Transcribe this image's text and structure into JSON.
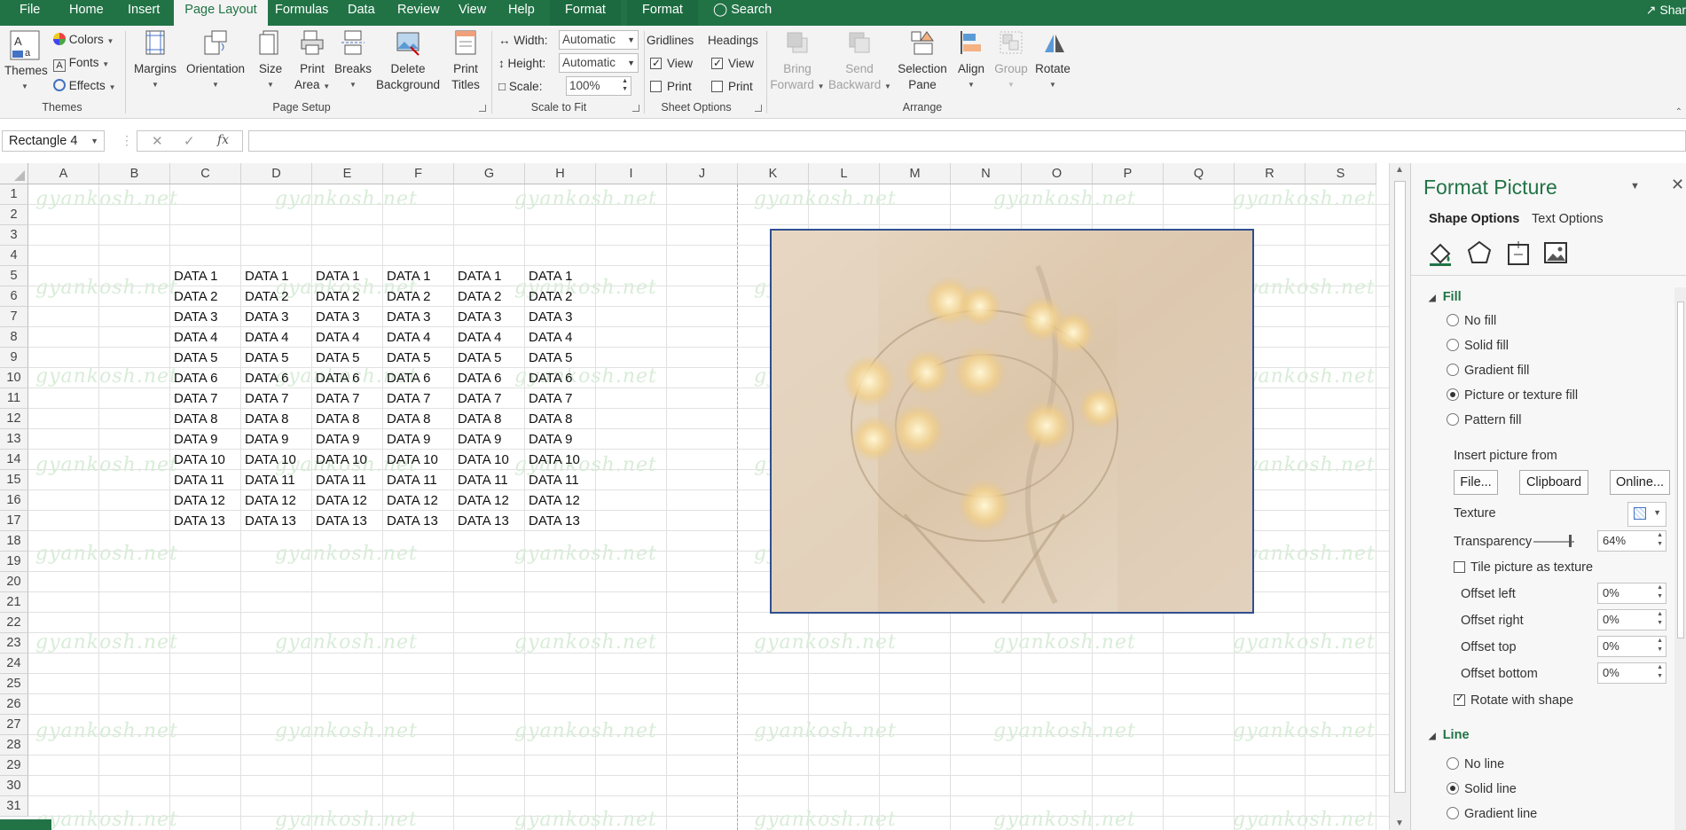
{
  "tabs": [
    "File",
    "Home",
    "Insert",
    "Page Layout",
    "Formulas",
    "Data",
    "Review",
    "View",
    "Help",
    "Format",
    "Format"
  ],
  "active_tab": "Page Layout",
  "search_label": "Search",
  "share_label": "Shar",
  "ribbon": {
    "themes": {
      "themes_label": "Themes",
      "colors": "Colors",
      "fonts": "Fonts",
      "effects": "Effects",
      "group": "Themes"
    },
    "page_setup": {
      "margins": "Margins",
      "orientation": "Orientation",
      "size": "Size",
      "print_area": [
        "Print",
        "Area"
      ],
      "breaks": "Breaks",
      "delete_background": [
        "Delete",
        "Background"
      ],
      "print_titles": [
        "Print",
        "Titles"
      ],
      "group": "Page Setup"
    },
    "scale_to_fit": {
      "width_label": "Width:",
      "width_value": "Automatic",
      "height_label": "Height:",
      "height_value": "Automatic",
      "scale_label": "Scale:",
      "scale_value": "100%",
      "group": "Scale to Fit"
    },
    "sheet_options": {
      "gridlines": "Gridlines",
      "headings": "Headings",
      "view": "View",
      "print": "Print",
      "group": "Sheet Options"
    },
    "arrange": {
      "bring_forward": [
        "Bring",
        "Forward"
      ],
      "send_backward": [
        "Send",
        "Backward"
      ],
      "selection_pane": [
        "Selection",
        "Pane"
      ],
      "align": "Align",
      "group_btn": "Group",
      "rotate": "Rotate",
      "group": "Arrange"
    }
  },
  "formula_bar": {
    "name_box": "Rectangle 4",
    "fx": "fx",
    "value": ""
  },
  "grid": {
    "columns": [
      "A",
      "B",
      "C",
      "D",
      "E",
      "F",
      "G",
      "H",
      "I",
      "J",
      "K",
      "L",
      "M",
      "N",
      "O",
      "P",
      "Q",
      "R",
      "S"
    ],
    "rows": [
      "1",
      "2",
      "3",
      "4",
      "5",
      "6",
      "7",
      "8",
      "9",
      "10",
      "11",
      "12",
      "13",
      "14",
      "15",
      "16",
      "17",
      "18",
      "19",
      "20",
      "21",
      "22",
      "23",
      "24",
      "25",
      "26",
      "27",
      "28",
      "29",
      "30",
      "31"
    ],
    "data_values": [
      "DATA 1",
      "DATA 2",
      "DATA 3",
      "DATA 4",
      "DATA 5",
      "DATA 6",
      "DATA 7",
      "DATA 8",
      "DATA 9",
      "DATA 10",
      "DATA 11",
      "DATA 12",
      "DATA 13"
    ],
    "data_columns": [
      "C",
      "D",
      "E",
      "F",
      "G",
      "H"
    ],
    "data_start_row": 5,
    "watermark": "gyankosh.net"
  },
  "pane": {
    "title": "Format Picture",
    "tab_shape": "Shape Options",
    "tab_text": "Text Options",
    "fill_header": "Fill",
    "fill_options": [
      "No fill",
      "Solid fill",
      "Gradient fill",
      "Picture or texture fill",
      "Pattern fill"
    ],
    "fill_selected": "Picture or texture fill",
    "insert_from": "Insert picture from",
    "btn_file": "File...",
    "btn_clipboard": "Clipboard",
    "btn_online": "Online...",
    "texture": "Texture",
    "transparency_label": "Transparency",
    "transparency_value": "64%",
    "tile_label": "Tile picture as texture",
    "offset_left_label": "Offset left",
    "offset_left": "0%",
    "offset_right_label": "Offset right",
    "offset_right": "0%",
    "offset_top_label": "Offset top",
    "offset_top": "0%",
    "offset_bottom_label": "Offset bottom",
    "offset_bottom": "0%",
    "rotate_label": "Rotate with shape",
    "line_header": "Line",
    "line_options": [
      "No line",
      "Solid line",
      "Gradient line"
    ],
    "line_selected": "Solid line"
  },
  "colors": {
    "excel_green": "#217346",
    "picture_border": "#2f4f8f",
    "watermark": "#d8ecd8"
  }
}
